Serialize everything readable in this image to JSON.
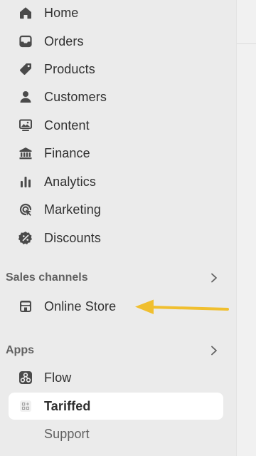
{
  "nav": {
    "items": [
      {
        "label": "Home",
        "icon": "home-icon"
      },
      {
        "label": "Orders",
        "icon": "inbox-icon"
      },
      {
        "label": "Products",
        "icon": "tag-icon"
      },
      {
        "label": "Customers",
        "icon": "person-icon"
      },
      {
        "label": "Content",
        "icon": "image-icon"
      },
      {
        "label": "Finance",
        "icon": "bank-icon"
      },
      {
        "label": "Analytics",
        "icon": "bar-chart-icon"
      },
      {
        "label": "Marketing",
        "icon": "target-icon"
      },
      {
        "label": "Discounts",
        "icon": "discount-badge-icon"
      }
    ]
  },
  "sales_channels": {
    "title": "Sales channels",
    "items": [
      {
        "label": "Online Store",
        "icon": "storefront-icon"
      }
    ]
  },
  "apps": {
    "title": "Apps",
    "items": [
      {
        "label": "Flow",
        "icon": "flow-icon"
      },
      {
        "label": "Tariffed",
        "icon": "app-grid-icon",
        "active": true
      },
      {
        "label": "Support"
      }
    ]
  },
  "annotation": {
    "type": "arrow",
    "color": "#f0bf2f",
    "points_to": "Online Store"
  },
  "colors": {
    "sidebar_bg": "#ebebeb",
    "active_bg": "#ffffff",
    "text": "#303030",
    "muted": "#616161"
  }
}
